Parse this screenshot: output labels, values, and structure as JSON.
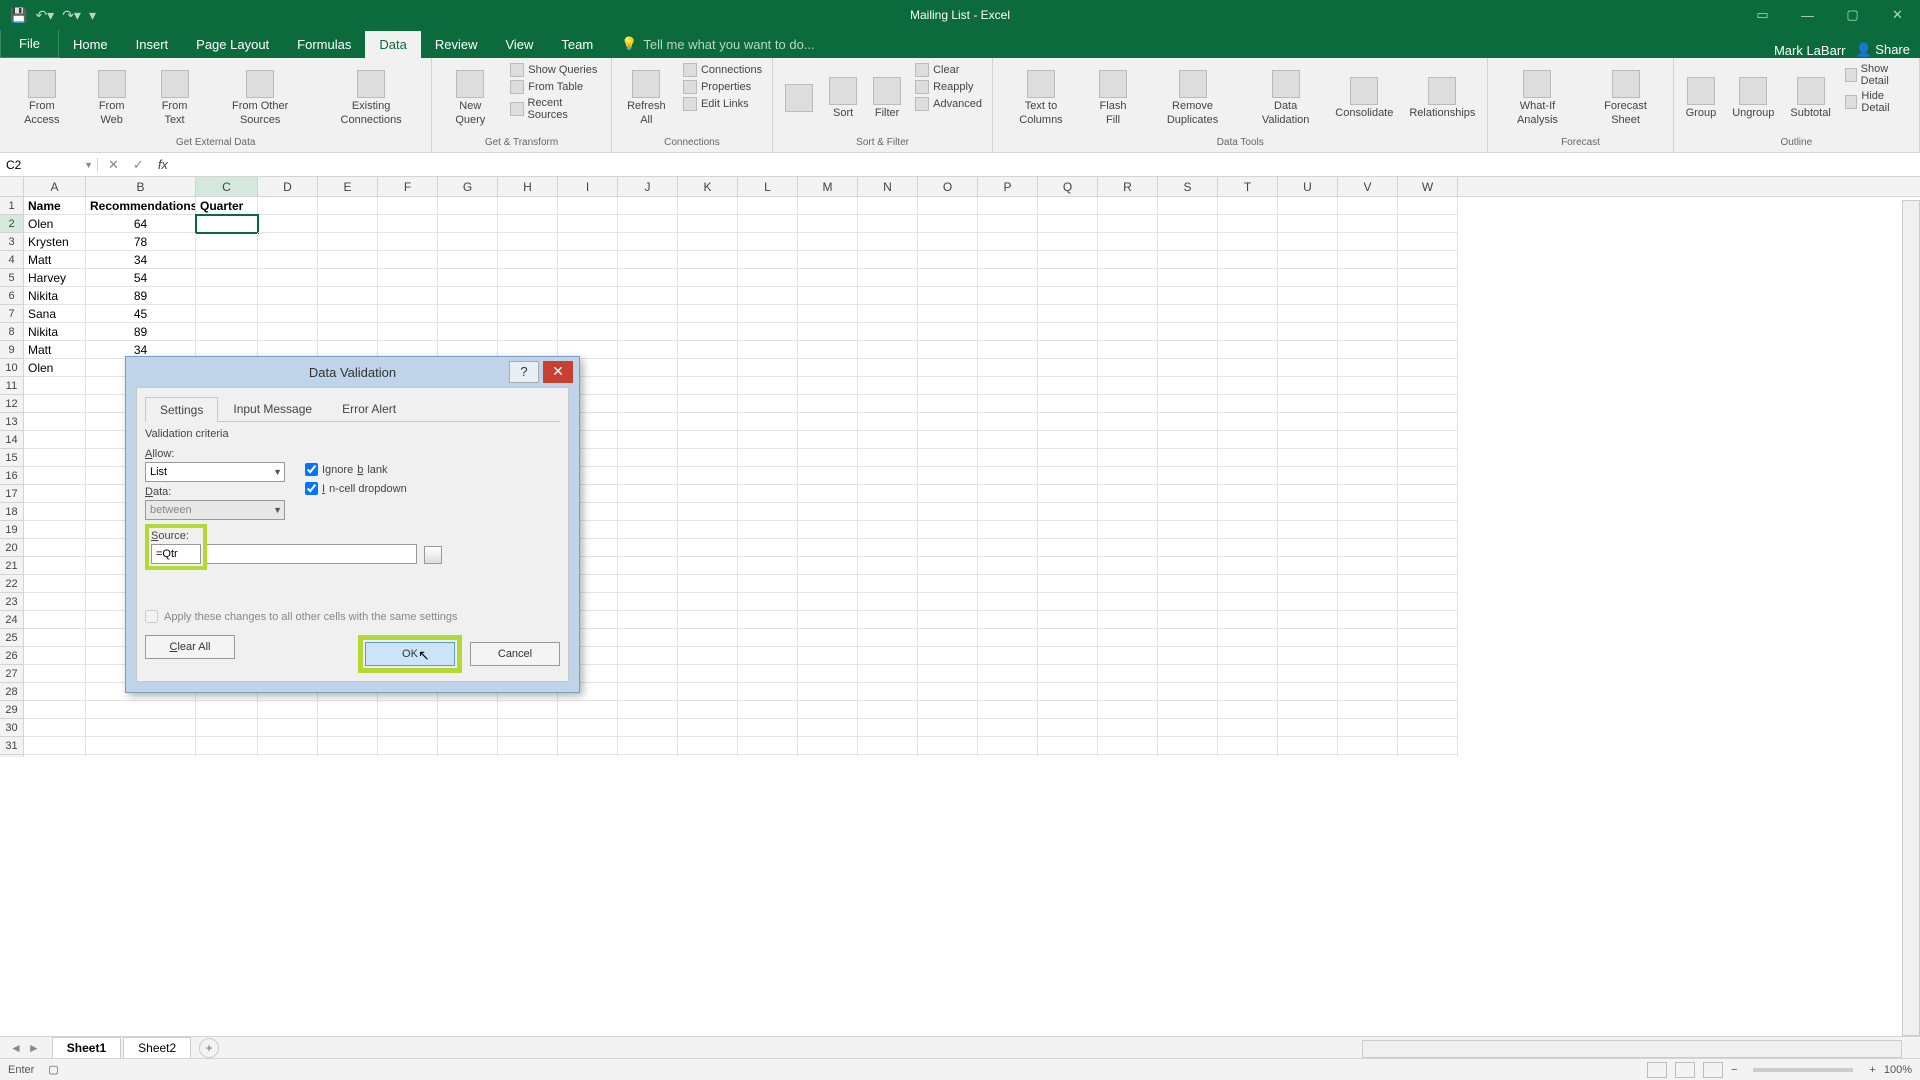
{
  "title": "Mailing List - Excel",
  "user": "Mark LaBarr",
  "share": "Share",
  "tabs": [
    "File",
    "Home",
    "Insert",
    "Page Layout",
    "Formulas",
    "Data",
    "Review",
    "View",
    "Team"
  ],
  "active_tab": "Data",
  "tellme": "Tell me what you want to do...",
  "ribbon_groups": {
    "g1": {
      "label": "Get External Data",
      "btns": [
        "From Access",
        "From Web",
        "From Text",
        "From Other Sources",
        "Existing Connections"
      ]
    },
    "g2": {
      "label": "Get & Transform",
      "main": "New Query",
      "items": [
        "Show Queries",
        "From Table",
        "Recent Sources"
      ]
    },
    "g3": {
      "label": "Connections",
      "main": "Refresh All",
      "items": [
        "Connections",
        "Properties",
        "Edit Links"
      ]
    },
    "g4": {
      "label": "Sort & Filter",
      "btns": [
        "Sort",
        "Filter"
      ],
      "items": [
        "Clear",
        "Reapply",
        "Advanced"
      ]
    },
    "g5": {
      "label": "Data Tools",
      "btns": [
        "Text to Columns",
        "Flash Fill",
        "Remove Duplicates",
        "Data Validation",
        "Consolidate",
        "Relationships"
      ]
    },
    "g6": {
      "label": "Forecast",
      "btns": [
        "What-If Analysis",
        "Forecast Sheet"
      ]
    },
    "g7": {
      "label": "Outline",
      "btns": [
        "Group",
        "Ungroup",
        "Subtotal"
      ],
      "items": [
        "Show Detail",
        "Hide Detail"
      ]
    }
  },
  "name_box": "C2",
  "columns": [
    "A",
    "B",
    "C",
    "D",
    "E",
    "F",
    "G",
    "H",
    "I",
    "J",
    "K",
    "L",
    "M",
    "N",
    "O",
    "P",
    "Q",
    "R",
    "S",
    "T",
    "U",
    "V",
    "W"
  ],
  "headers": [
    "Name",
    "Recommendations",
    "Quarter"
  ],
  "rows": [
    [
      "Olen",
      "64",
      ""
    ],
    [
      "Krysten",
      "78",
      ""
    ],
    [
      "Matt",
      "34",
      ""
    ],
    [
      "Harvey",
      "54",
      ""
    ],
    [
      "Nikita",
      "89",
      ""
    ],
    [
      "Sana",
      "45",
      ""
    ],
    [
      "Nikita",
      "89",
      ""
    ],
    [
      "Matt",
      "34",
      ""
    ],
    [
      "Olen",
      "",
      ""
    ]
  ],
  "dialog": {
    "title": "Data Validation",
    "tabs": [
      "Settings",
      "Input Message",
      "Error Alert"
    ],
    "active_tab": "Settings",
    "criteria_label": "Validation criteria",
    "allow_label": "Allow:",
    "allow_value": "List",
    "data_label": "Data:",
    "data_value": "between",
    "source_label": "Source:",
    "source_value": "=Qtr",
    "ignore_blank": "Ignore blank",
    "incell": "In-cell dropdown",
    "apply": "Apply these changes to all other cells with the same settings",
    "clear": "Clear All",
    "ok": "OK",
    "cancel": "Cancel"
  },
  "sheets": [
    "Sheet1",
    "Sheet2"
  ],
  "active_sheet": "Sheet1",
  "status": "Enter",
  "zoom": "100%"
}
